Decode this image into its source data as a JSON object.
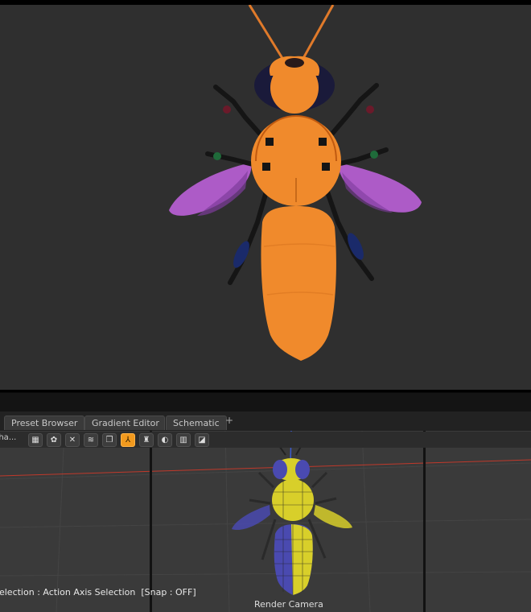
{
  "tabs": [
    {
      "label": "Preset Browser"
    },
    {
      "label": "Gradient Editor"
    },
    {
      "label": "Schematic"
    }
  ],
  "tab_add_label": "+",
  "toolbar": {
    "truncated_label": "Sha...",
    "tools": [
      {
        "icon": "checker-icon",
        "glyph": "▦",
        "active": false
      },
      {
        "icon": "nodes-icon",
        "glyph": "✿",
        "active": false
      },
      {
        "icon": "cross-box-icon",
        "glyph": "✕",
        "active": false
      },
      {
        "icon": "wave-icon",
        "glyph": "≋",
        "active": false
      },
      {
        "icon": "layers-icon",
        "glyph": "❐",
        "active": false
      },
      {
        "icon": "axis-select-icon",
        "glyph": "⅄",
        "active": true
      },
      {
        "icon": "gimbal-icon",
        "glyph": "♜",
        "active": false
      },
      {
        "icon": "half-circle-icon",
        "glyph": "◐",
        "active": false
      },
      {
        "icon": "pages-icon",
        "glyph": "▥",
        "active": false
      },
      {
        "icon": "slash-box-icon",
        "glyph": "◪",
        "active": false
      }
    ]
  },
  "status": {
    "text": "Selection : Action Axis Selection  [Snap : OFF]"
  },
  "viewport": {
    "camera_label": "Render Camera"
  },
  "colors": {
    "body_orange": "#f08a2c",
    "wing_purple": "#b45ed0",
    "mesh_yellow": "#d8cf2a",
    "mesh_blue": "#4a4ab0",
    "active_tool": "#f29a1e",
    "horizon_line": "#c0392b"
  }
}
